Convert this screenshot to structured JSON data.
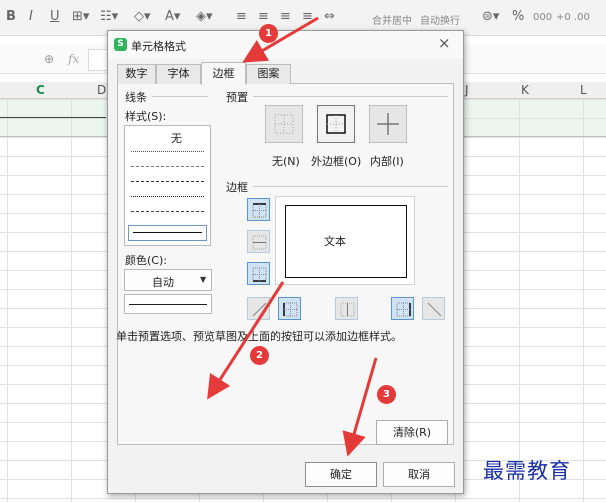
{
  "toolbar": {
    "bold": "B",
    "italic": "I",
    "underline": "U",
    "merge_center": "合并居中",
    "wrap_text": "自动换行",
    "percent": "%",
    "thousands": "000",
    "inc_decimal": "+0 .00",
    "dec_decimal": ".00 +.0"
  },
  "formula_bar": {
    "fx": "fx"
  },
  "columns": [
    "C",
    "D",
    "J",
    "K",
    "L"
  ],
  "dialog": {
    "title": "单元格格式",
    "tabs": [
      "数字",
      "字体",
      "边框",
      "图案"
    ],
    "active_tab": "边框",
    "line_group": {
      "title": "线条",
      "style_label": "样式(S):",
      "none_style": "无",
      "color_label": "颜色(C):",
      "color_value": "自动"
    },
    "presets": {
      "title": "预置",
      "none": "无(N)",
      "outline": "外边框(O)",
      "inside": "内部(I)"
    },
    "border": {
      "title": "边框",
      "preview_text": "文本"
    },
    "hint": "单击预置选项、预览草图及上面的按钮可以添加边框样式。",
    "clear_button": "清除(R)",
    "ok_button": "确定",
    "cancel_button": "取消"
  },
  "annotations": {
    "step1": "1",
    "step2": "2",
    "step3": "3"
  },
  "watermark": "最需教育",
  "colors": {
    "arrow_red": "#e43a3a",
    "watermark_blue": "#1a2fa5",
    "selected_border_bg": "#cfe3f7"
  }
}
